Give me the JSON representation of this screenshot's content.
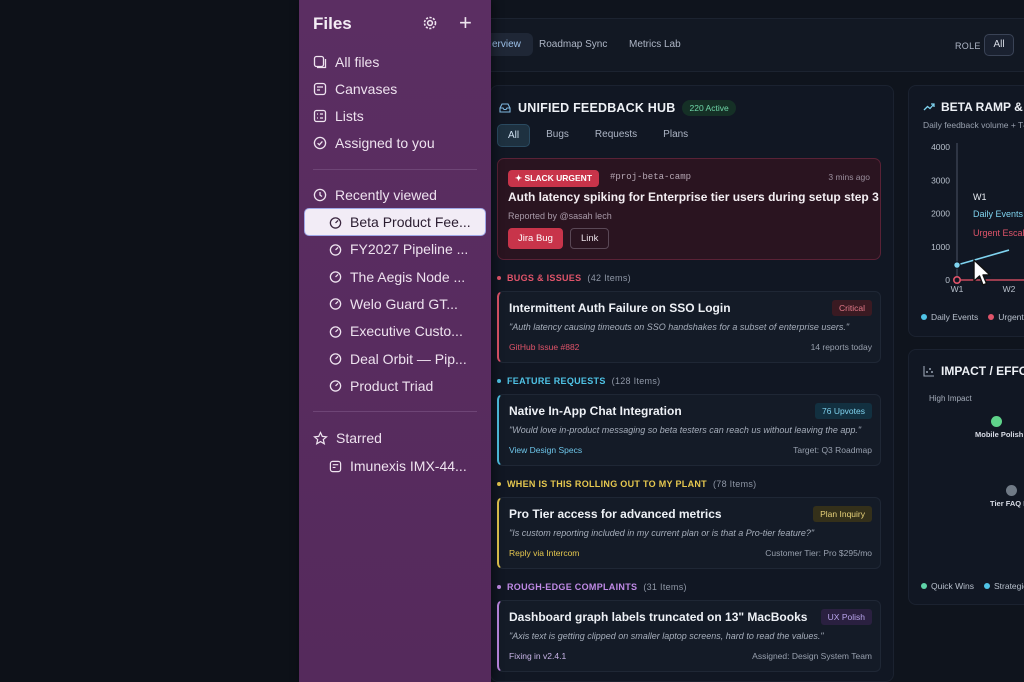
{
  "topbar": {
    "tabs": [
      "erview",
      "Roadmap Sync",
      "Metrics Lab"
    ],
    "role_label": "ROLE",
    "role_value": "All"
  },
  "hub": {
    "title": "UNIFIED FEEDBACK HUB",
    "active_badge": "220 Active",
    "filters": [
      "All",
      "Bugs",
      "Requests",
      "Plans"
    ],
    "urgent": {
      "tag": "SLACK URGENT",
      "channel": "#proj-beta-camp",
      "time": "3 mins ago",
      "title": "Auth latency spiking for Enterprise tier users during setup step 3",
      "reported_by": "Reported by @sasah lech",
      "jira_button": "Jira Bug",
      "link_button": "Link"
    },
    "sections": [
      {
        "name": "BUGS & ISSUES",
        "count": "(42 Items)",
        "color": "#e0546a",
        "card": {
          "title": "Intermittent Auth Failure on SSO Login",
          "badge": "Critical",
          "badge_bg": "#3a1a22",
          "badge_fg": "#e47a8a",
          "quote": "\"Auth latency causing timeouts on SSO handshakes for a subset of enterprise users.\"",
          "link": "GitHub Issue #882",
          "link_color": "#e0546a",
          "meta": "14 reports today"
        }
      },
      {
        "name": "FEATURE REQUESTS",
        "count": "(128 Items)",
        "color": "#4fc3e6",
        "card": {
          "title": "Native In-App Chat Integration",
          "badge": "76 Upvotes",
          "badge_bg": "#123040",
          "badge_fg": "#7fd3ef",
          "quote": "\"Would love in-product messaging so beta testers can reach us without leaving the app.\"",
          "link": "View Design Specs",
          "link_color": "#6ec6ea",
          "meta": "Target: Q3 Roadmap"
        }
      },
      {
        "name": "WHEN IS THIS ROLLING OUT TO MY PLANT",
        "count": "(78 Items)",
        "color": "#e6c84f",
        "card": {
          "title": "Pro Tier access for advanced metrics",
          "badge": "Plan Inquiry",
          "badge_bg": "#34301a",
          "badge_fg": "#e8d27a",
          "quote": "\"Is custom reporting included in my current plan or is that a Pro-tier feature?\"",
          "link": "Reply via Intercom",
          "link_color": "#e6c84f",
          "meta": "Customer Tier: Pro $295/mo"
        }
      },
      {
        "name": "ROUGH-EDGE COMPLAINTS",
        "count": "(31 Items)",
        "color": "#c08ae6",
        "card": {
          "title": "Dashboard graph labels truncated on 13\" MacBooks",
          "badge": "UX Polish",
          "badge_bg": "#2a2040",
          "badge_fg": "#b9a4ec",
          "quote": "\"Axis text is getting clipped on smaller laptop screens, hard to read the values.\"",
          "link": "Fixing in v2.4.1",
          "link_color": "#c9b6e8",
          "meta": "Assigned: Design System Team"
        }
      }
    ]
  },
  "ramp": {
    "title": "BETA RAMP &",
    "subtitle": "Daily feedback volume + T48",
    "legend": [
      "Daily Events",
      "Urgent"
    ],
    "legend_colors": [
      "#4fc3e6",
      "#e0546a"
    ]
  },
  "chart_data": {
    "type": "line",
    "x": [
      "W1",
      "W2"
    ],
    "series": [
      {
        "name": "Daily Events",
        "values": [
          450,
          900
        ]
      },
      {
        "name": "Urgent",
        "values": [
          0,
          0
        ]
      }
    ],
    "ylabel": "",
    "ylim": [
      0,
      4000
    ],
    "yticks": [
      "4000",
      "3000",
      "2000",
      "1000",
      "0"
    ],
    "tooltip": {
      "label": "W1",
      "line1": "Daily Events",
      "line2": "Urgent Escal"
    }
  },
  "impact": {
    "title": "IMPACT / EFFO",
    "axis_label": "High Impact",
    "points": [
      {
        "label": "Mobile Polish",
        "color": "#5fd38a"
      },
      {
        "label": "Tier FAQ D",
        "color": "#707a86"
      }
    ],
    "legend": [
      "Quick Wins",
      "Strategic"
    ],
    "legend_colors": [
      "#5fd3a8",
      "#4fc3e6"
    ]
  },
  "sidebar": {
    "title": "Files",
    "items": [
      "All files",
      "Canvases",
      "Lists",
      "Assigned to you"
    ],
    "recent_label": "Recently viewed",
    "recent": [
      "Beta Product Fee...",
      "FY2027 Pipeline ...",
      "The Aegis Node ...",
      "Welo Guard GT...",
      "Executive Custo...",
      "Deal Orbit — Pip...",
      "Product Triad"
    ],
    "starred_label": "Starred",
    "starred": [
      "Imunexis IMX-44..."
    ]
  }
}
